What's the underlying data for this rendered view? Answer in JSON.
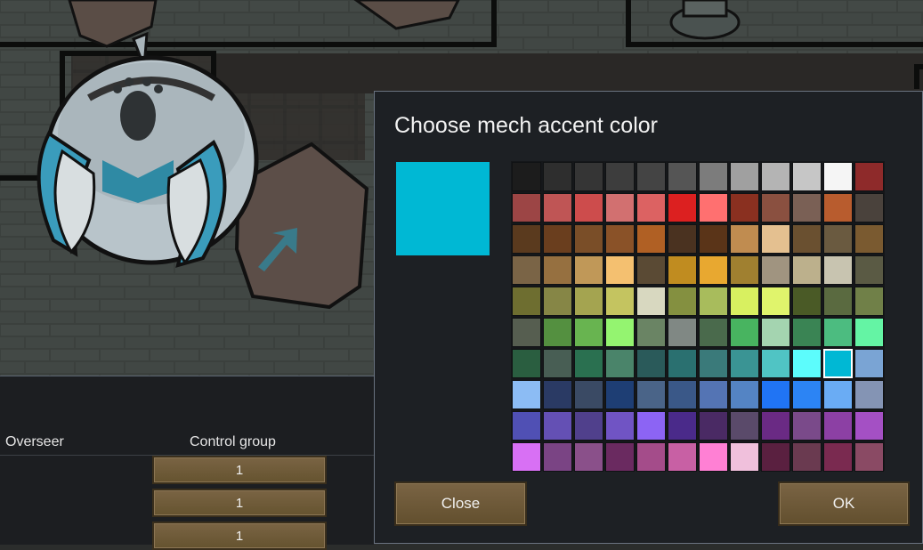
{
  "dialog": {
    "title": "Choose mech accent color",
    "selected_color": "#00b8d4",
    "close_label": "Close",
    "ok_label": "OK",
    "palette": [
      [
        "#1c1c1c",
        "#2e2e2e",
        "#353535",
        "#3d3d3d",
        "#444444",
        "#555555",
        "#7c7c7c",
        "#a0a0a0",
        "#b4b4b4",
        "#c6c6c6",
        "#f5f5f5",
        "#8e2a2a"
      ],
      [
        "#9c4545",
        "#bf5555",
        "#cd4c4c",
        "#d27070",
        "#dc6262",
        "#dc2020",
        "#ff7070",
        "#8a3020",
        "#8a5040",
        "#7a6055",
        "#b85c2e",
        "#4a423c"
      ],
      [
        "#5a3a1e",
        "#6a3e1e",
        "#7a4e28",
        "#8a5228",
        "#b06024",
        "#4a3220",
        "#5a3418",
        "#c08c50",
        "#e4c090",
        "#6a5030",
        "#6a5a40",
        "#7a5a30"
      ],
      [
        "#7a6446",
        "#967040",
        "#c09858",
        "#f4c070",
        "#5a4a34",
        "#c08c20",
        "#e8a830",
        "#a08030",
        "#a09480",
        "#bcb08c",
        "#c8c4b0",
        "#5a5a44"
      ],
      [
        "#6e6e30",
        "#868646",
        "#a4a450",
        "#c4c460",
        "#d8d8c0",
        "#849040",
        "#a8bc5c",
        "#d8f060",
        "#e0f46c",
        "#4a5a26",
        "#5a6a40",
        "#708048"
      ],
      [
        "#565e50",
        "#549040",
        "#68b450",
        "#94f470",
        "#6a8464",
        "#808884",
        "#4a6a4c",
        "#48b460",
        "#a4d4b0",
        "#3a8454",
        "#4cbc80",
        "#64f4a4"
      ],
      [
        "#2a5e40",
        "#485e54",
        "#2a7050",
        "#4a846a",
        "#2a5a5a",
        "#2a7070",
        "#3a7a7a",
        "#3a9494",
        "#50c4c4",
        "#5cfcfc",
        "#00b8d4",
        "#7aa4d4"
      ],
      [
        "#8cbcf4",
        "#2a3a64",
        "#3a4a64",
        "#1e3e74",
        "#4a6488",
        "#3a5888",
        "#5474b4",
        "#5484c4",
        "#2074f4",
        "#2c84f4",
        "#6aacf4",
        "#8494b4"
      ],
      [
        "#5050b4",
        "#6450b4",
        "#50408c",
        "#7054c4",
        "#8c64f4",
        "#4a2a8a",
        "#4a2a64",
        "#5a4a6a",
        "#6a2a84",
        "#7a4a8a",
        "#8c40a4",
        "#a450c4"
      ],
      [
        "#d870f4",
        "#7a4484",
        "#8a508a",
        "#6a2a60",
        "#a44c8a",
        "#c860a4",
        "#ff80d4",
        "#f0c0dc",
        "#5a2040",
        "#6a3a50",
        "#7a2a50",
        "#8a4a64"
      ]
    ]
  },
  "table": {
    "columns": [
      "Overseer",
      "Control group"
    ],
    "control_group_values": [
      "1",
      "1",
      "1"
    ]
  }
}
